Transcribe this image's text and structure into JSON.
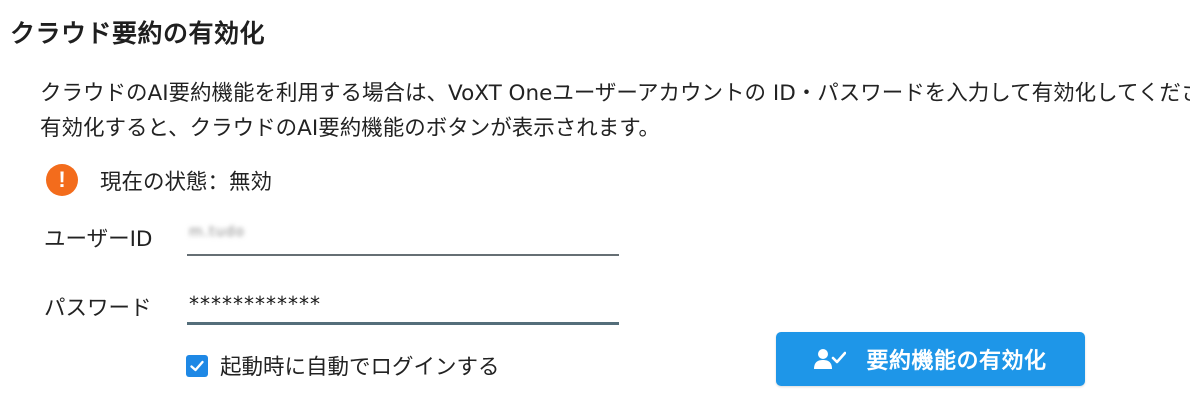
{
  "section": {
    "title": "クラウド要約の有効化",
    "description_line1": "クラウドのAI要約機能を利用する場合は、VoXT Oneユーザーアカウントの ID・パスワードを入力して有効化してください。",
    "description_line2": "有効化すると、クラウドのAI要約機能のボタンが表示されます。"
  },
  "status": {
    "icon": "warning-icon",
    "text": "現在の状態：無効",
    "icon_color": "#f36c1c"
  },
  "form": {
    "user_id_label": "ユーザーID",
    "user_id_value": "m.tudo",
    "password_label": "パスワード",
    "password_value": "************",
    "auto_login_label": "起動時に自動でログインする",
    "auto_login_checked": true
  },
  "actions": {
    "enable_label": "要約機能の有効化",
    "enable_icon": "user-check-icon",
    "button_color": "#1e96e8"
  }
}
